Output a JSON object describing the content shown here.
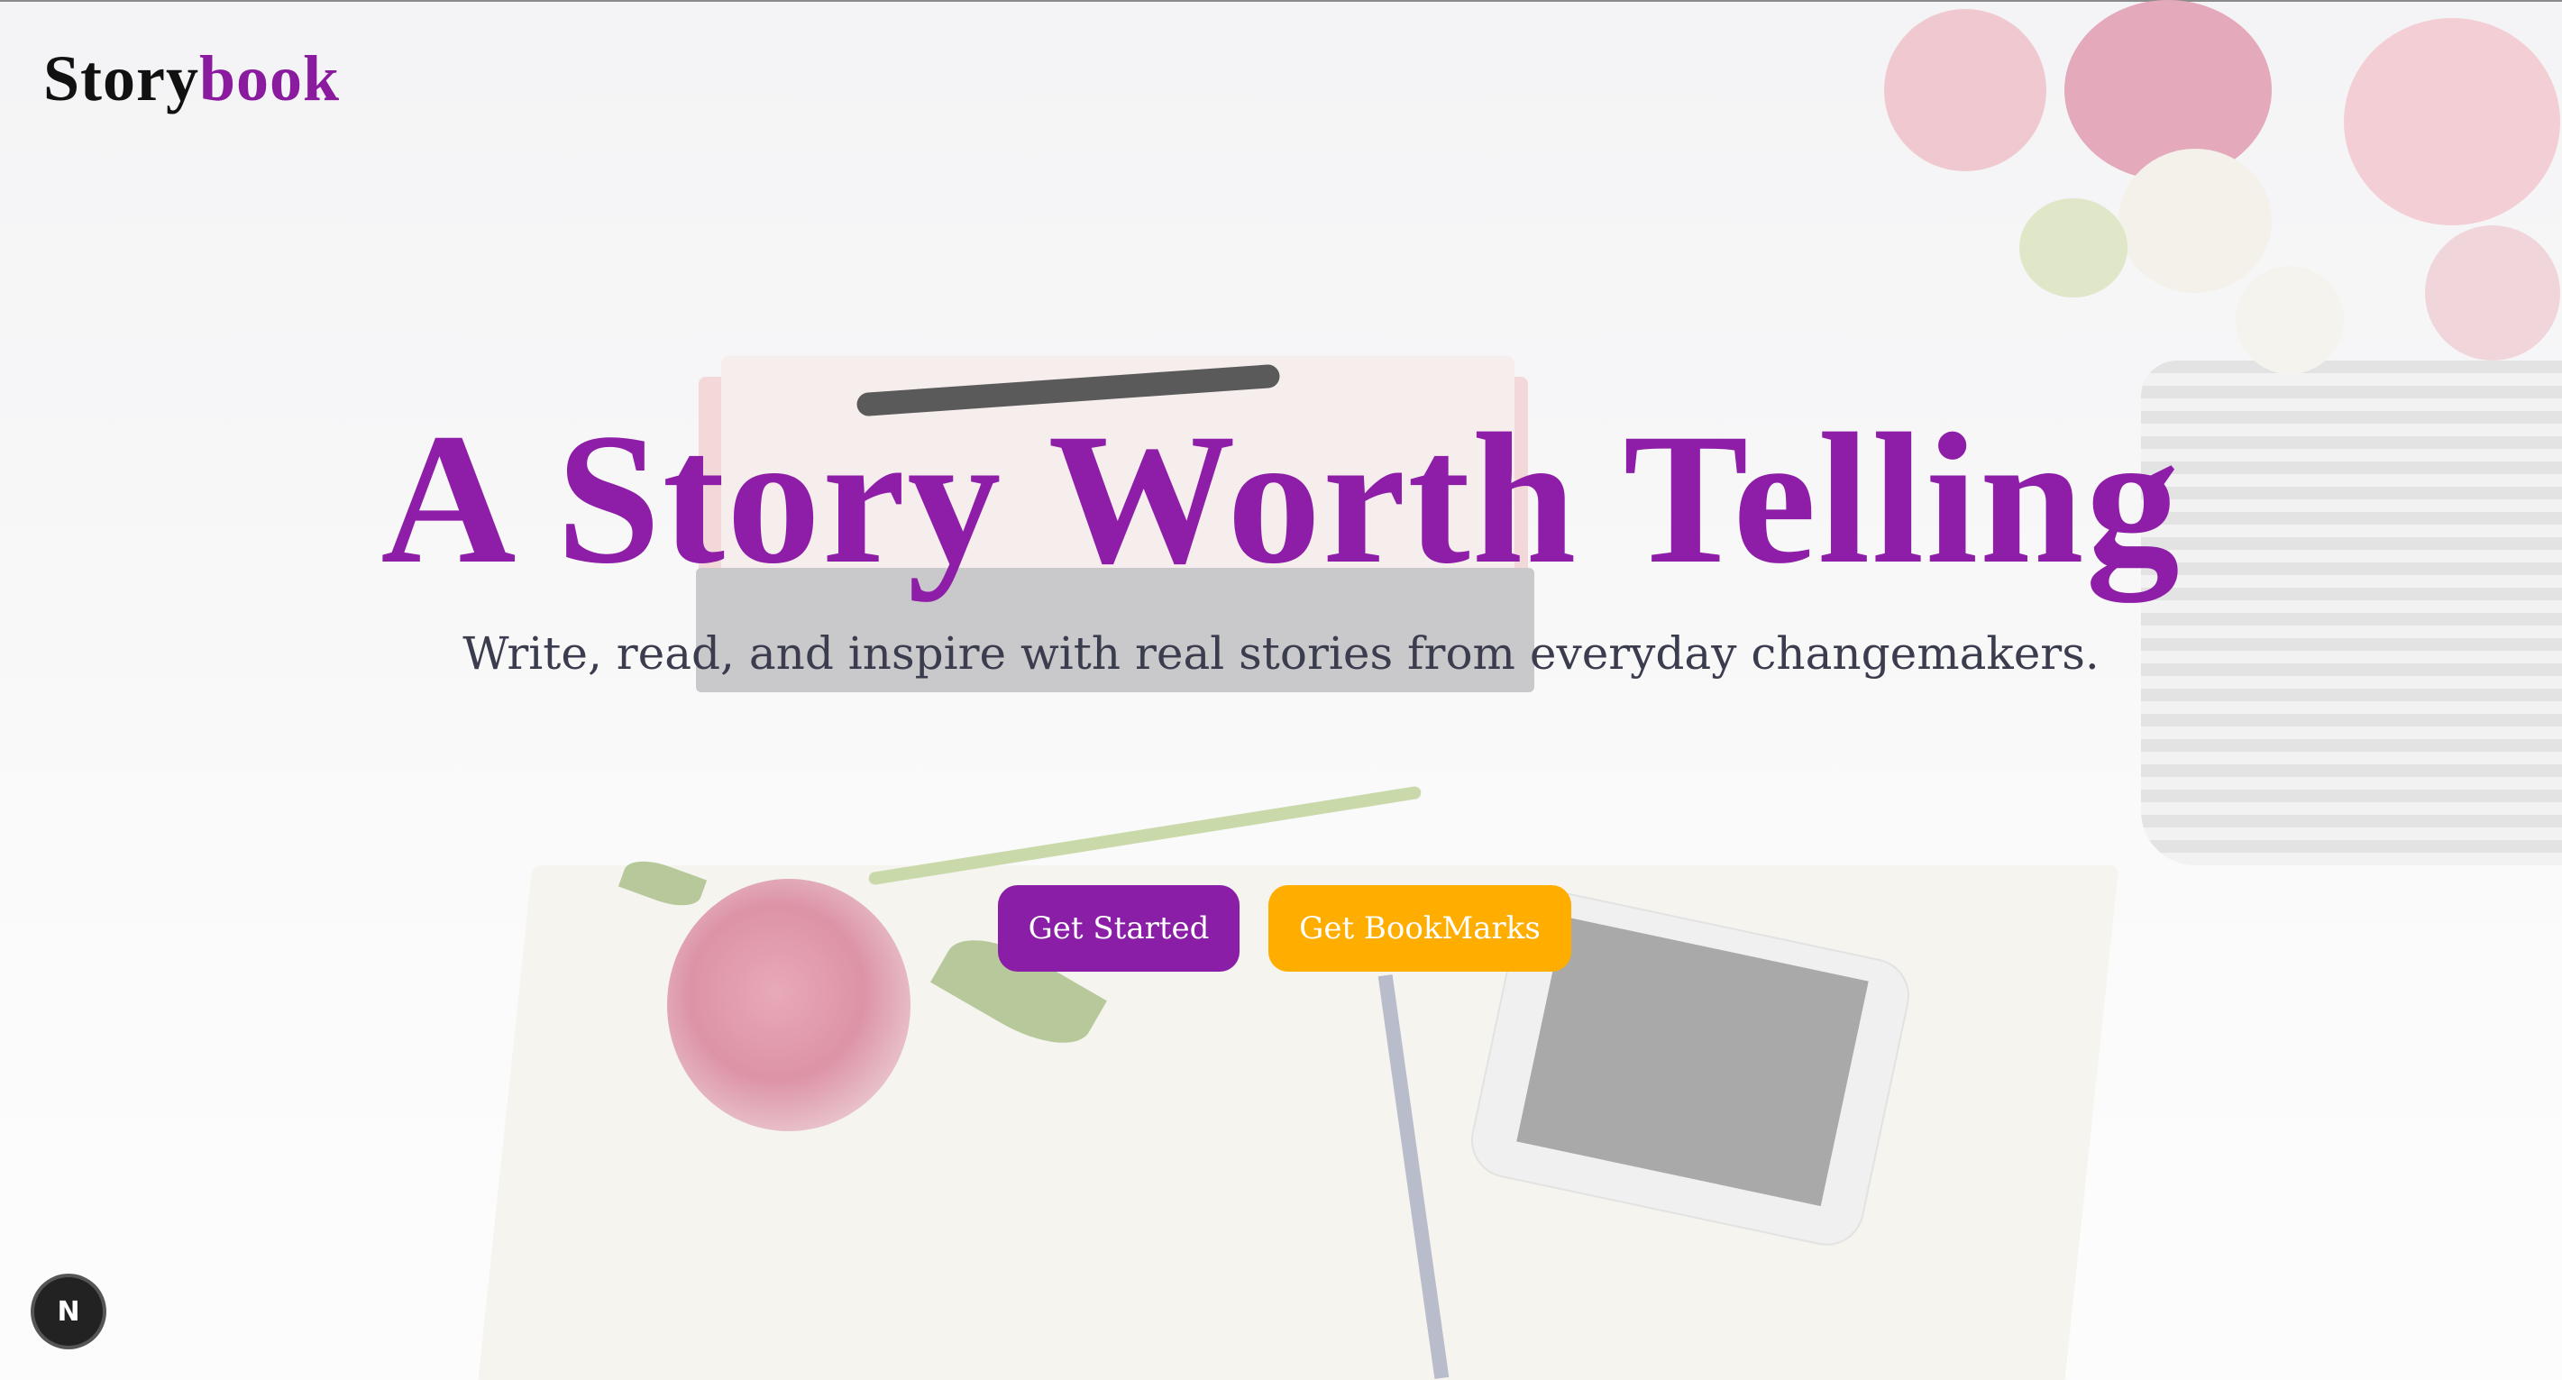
{
  "header": {
    "logo_part1": "Story",
    "logo_part2": "book"
  },
  "hero": {
    "title": "A Story Worth Telling",
    "subtitle": "Write, read, and inspire with real stories from everyday changemakers."
  },
  "actions": {
    "primary_label": "Get Started",
    "secondary_label": "Get BookMarks"
  },
  "dev_badge": {
    "label": "N"
  },
  "colors": {
    "brand_purple": "#8e1ea8",
    "button_purple": "#8a1ea6",
    "button_amber": "#ffae00",
    "subtitle_text": "#3b3d4f"
  },
  "icons": {
    "dev_badge_icon": "nextjs-icon"
  }
}
